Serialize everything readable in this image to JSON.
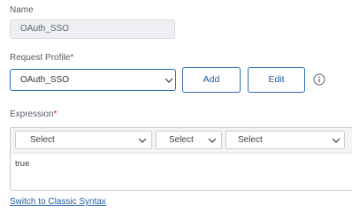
{
  "name_field": {
    "label": "Name",
    "value": "OAuth_SSO"
  },
  "request_profile": {
    "label": "Request Profile",
    "required_mark": "*",
    "selected": "OAuth_SSO",
    "add_label": "Add",
    "edit_label": "Edit",
    "info_icon": "info-circle-icon"
  },
  "expression": {
    "label": "Expression",
    "required_mark": "*",
    "selectors": [
      "Select",
      "Select",
      "Select"
    ],
    "value": "true"
  },
  "switch_link": "Switch to Classic Syntax",
  "colors": {
    "accent": "#2f6db3",
    "required": "#c62828"
  }
}
